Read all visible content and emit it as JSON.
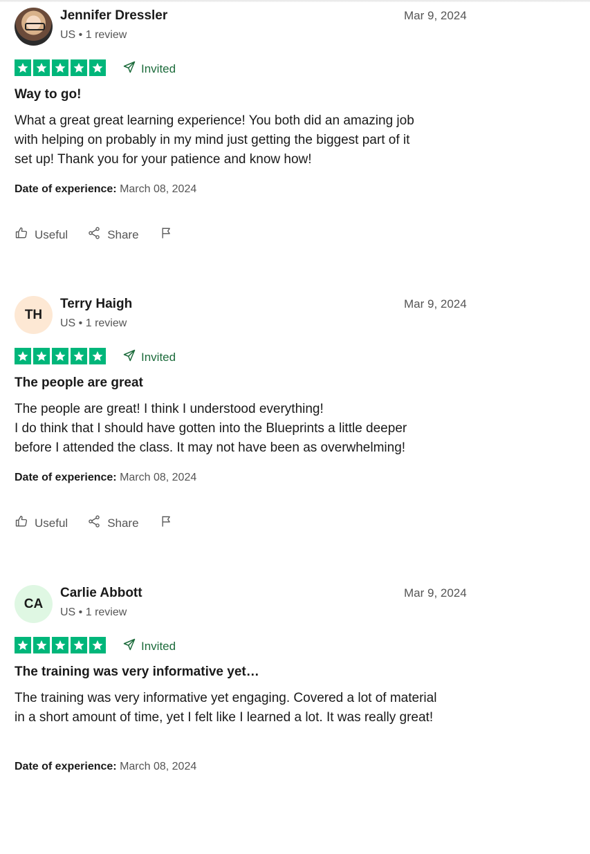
{
  "reviews": [
    {
      "name": "Jennifer Dressler",
      "initials": "",
      "avatar_type": "photo",
      "avatar_bg": "",
      "meta": "US • 1 review",
      "date": "Mar 9, 2024",
      "rating": 5,
      "invited_label": "Invited",
      "title": "Way to go!",
      "body_lines": [
        "What a great great learning experience! You both did an amazing job",
        "with helping on probably in my mind just getting the biggest part of it",
        "set up! Thank you for your patience and know how!"
      ],
      "exp_label": "Date of experience:",
      "exp_value": "March 08, 2024",
      "useful_label": "Useful",
      "share_label": "Share"
    },
    {
      "name": "Terry Haigh",
      "initials": "TH",
      "avatar_type": "initials",
      "avatar_bg": "#fde8d4",
      "meta": "US • 1 review",
      "date": "Mar 9, 2024",
      "rating": 5,
      "invited_label": "Invited",
      "title": "The people are great",
      "body_lines": [
        "The people are great! I think I understood everything!",
        "I do think that I should have gotten into the Blueprints a little deeper",
        "before I attended the class. It may not have been as overwhelming!"
      ],
      "exp_label": "Date of experience:",
      "exp_value": "March 08, 2024",
      "useful_label": "Useful",
      "share_label": "Share"
    },
    {
      "name": "Carlie Abbott",
      "initials": "CA",
      "avatar_type": "initials",
      "avatar_bg": "#dff7e3",
      "meta": "US • 1 review",
      "date": "Mar 9, 2024",
      "rating": 5,
      "invited_label": "Invited",
      "title": "The training was very informative yet…",
      "body_lines": [
        "The training was very informative yet engaging. Covered a lot of material",
        "in a short amount of time, yet I felt like I learned a lot. It was really great!"
      ],
      "exp_label": "Date of experience:",
      "exp_value": "March 08, 2024",
      "useful_label": "",
      "share_label": ""
    }
  ],
  "colors": {
    "star_green": "#00b67a",
    "invited_green": "#1c6b3b",
    "muted_text": "#555555"
  },
  "icons": [
    "thumbs-up-icon",
    "share-icon",
    "flag-icon",
    "paper-plane-icon",
    "star-icon"
  ]
}
